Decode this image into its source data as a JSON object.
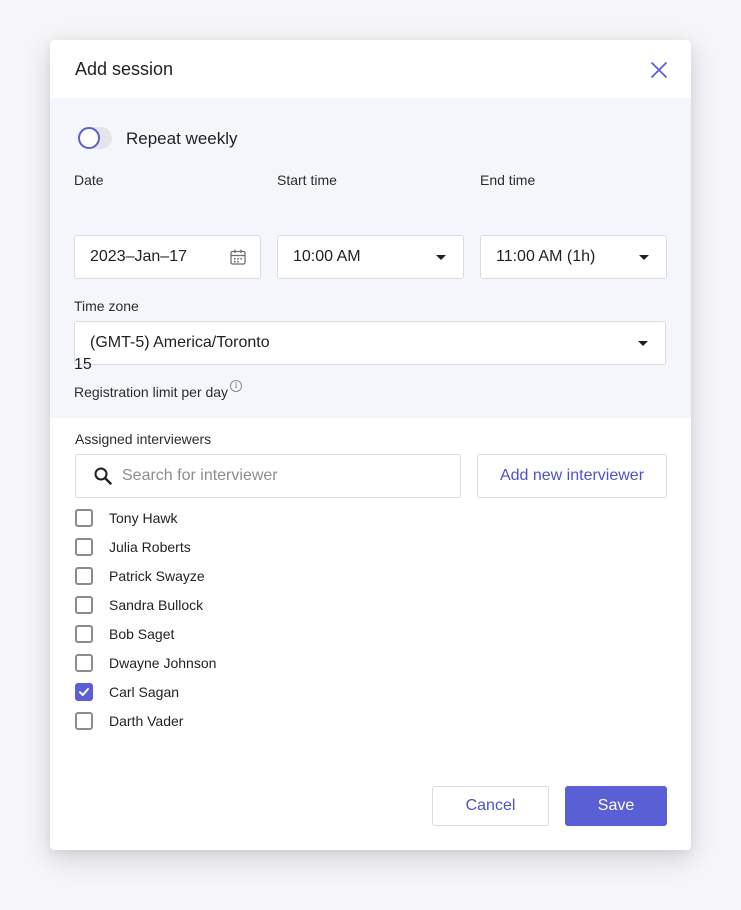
{
  "modal": {
    "title": "Add session",
    "close_icon": "close-icon"
  },
  "repeat": {
    "label": "Repeat weekly",
    "enabled": false
  },
  "date": {
    "label": "Date",
    "value": "2023–Jan–17",
    "icon": "calendar-icon"
  },
  "start_time": {
    "label": "Start time",
    "value": "10:00 AM",
    "icon": "caret-down-icon"
  },
  "end_time": {
    "label": "End time",
    "value": "11:00 AM (1h)",
    "icon": "caret-down-icon"
  },
  "timezone": {
    "label": "Time zone",
    "value": "(GMT-5) America/Toronto",
    "icon": "caret-down-icon"
  },
  "registration": {
    "label": "Registration limit per day",
    "info_icon": "info-icon",
    "value": "15"
  },
  "interviewers": {
    "label": "Assigned interviewers",
    "search_placeholder": "Search for interviewer",
    "search_icon": "search-icon",
    "add_button_label": "Add new interviewer",
    "items": [
      {
        "name": "Tony Hawk",
        "checked": false
      },
      {
        "name": "Julia Roberts",
        "checked": false
      },
      {
        "name": "Patrick Swayze",
        "checked": false
      },
      {
        "name": "Sandra Bullock",
        "checked": false
      },
      {
        "name": "Bob Saget",
        "checked": false
      },
      {
        "name": "Dwayne Johnson",
        "checked": false
      },
      {
        "name": "Carl Sagan",
        "checked": true
      },
      {
        "name": "Darth Vader",
        "checked": false
      }
    ]
  },
  "footer": {
    "cancel_label": "Cancel",
    "save_label": "Save"
  },
  "colors": {
    "accent": "#5a5fd6",
    "accent_text": "#4d52c9",
    "settings_bg": "#f4f6fc"
  }
}
